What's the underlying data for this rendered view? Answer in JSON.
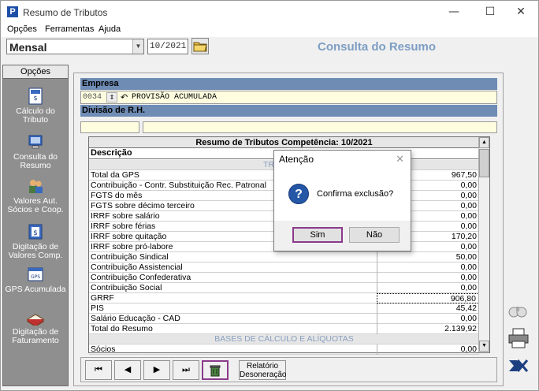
{
  "window": {
    "title": "Resumo de Tributos",
    "minimize": "—",
    "maximize": "☐",
    "close": "✕"
  },
  "menu": [
    "Opções",
    "Ferramentas",
    "Ajuda"
  ],
  "toolbar": {
    "period_type": "Mensal",
    "competence": "10/2021",
    "page_title": "Consulta do Resumo"
  },
  "sidebar": {
    "header": "Opções",
    "items": [
      {
        "label": "Cálculo do Tributo",
        "icon": "calculator-icon"
      },
      {
        "label": "Consulta do Resumo",
        "icon": "computer-icon"
      },
      {
        "label": "Valores Aut. Sócios e Coop.",
        "icon": "people-icon"
      },
      {
        "label": "Digitação de Valores Comp.",
        "icon": "dollar-doc-icon"
      },
      {
        "label": "GPS Acumulada",
        "icon": "gps-icon"
      },
      {
        "label": "Digitação de Faturamento",
        "icon": "book-icon"
      }
    ]
  },
  "company": {
    "header": "Empresa",
    "code": "0034",
    "name": "PROVISÃO ACUMULADA",
    "division_header": "Divisão de R.H."
  },
  "grid": {
    "title": "Resumo de Tributos Competência: 10/2021",
    "column": "Descrição",
    "section_taxes": "TRIBUTOS",
    "rows": [
      {
        "d": "Total da GPS",
        "v": "967,50"
      },
      {
        "d": "Contribuição - Contr. Substituição Rec. Patronal",
        "v": "0,00"
      },
      {
        "d": "FGTS do mês",
        "v": "0,00"
      },
      {
        "d": "FGTS sobre décimo terceiro",
        "v": "0,00"
      },
      {
        "d": "IRRF sobre salário",
        "v": "0,00"
      },
      {
        "d": "IRRF sobre férias",
        "v": "0,00"
      },
      {
        "d": "IRRF sobre quitação",
        "v": "170,20"
      },
      {
        "d": "IRRF sobre pró-labore",
        "v": "0,00"
      },
      {
        "d": "Contribuição Sindical",
        "v": "50,00"
      },
      {
        "d": "Contribuição Assistencial",
        "v": "0,00"
      },
      {
        "d": "Contribuição Confederativa",
        "v": "0,00"
      },
      {
        "d": "Contribuição Social",
        "v": "0,00"
      },
      {
        "d": "GRRF",
        "v": "906,80"
      },
      {
        "d": "PIS",
        "v": "45,42"
      },
      {
        "d": "Salário Educação - CAD",
        "v": "0,00"
      },
      {
        "d": "Total do Resumo",
        "v": "2.139,92"
      }
    ],
    "section_bases": "BASES DE CÁLCULO E ALÍQUOTAS",
    "last_row": {
      "d": "Sócios",
      "v": "0,00"
    }
  },
  "nav": {
    "first": "⏮",
    "prev": "◀",
    "next": "▶",
    "last": "⏭",
    "report": "Relatório Desoneração"
  },
  "dialog": {
    "title": "Atenção",
    "icon": "question-icon",
    "mark": "?",
    "message": "Confirma exclusão?",
    "yes": "Sim",
    "no": "Não"
  }
}
